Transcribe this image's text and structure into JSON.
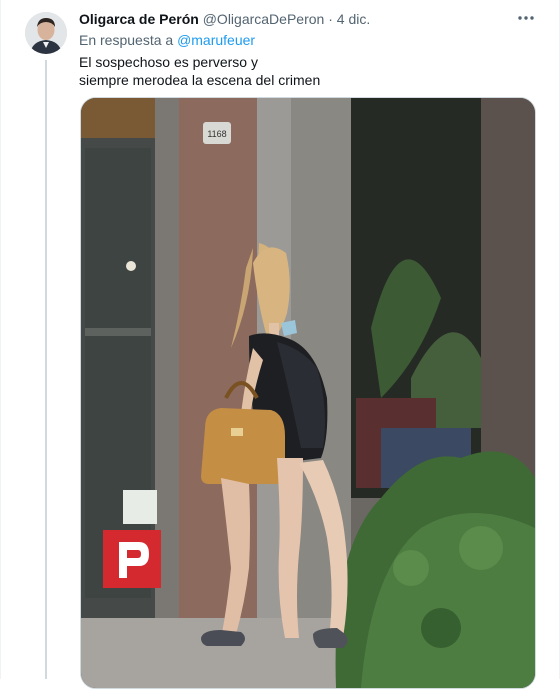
{
  "tweet": {
    "display_name": "Oligarca de Perón",
    "handle": "@OligarcaDePeron",
    "separator": "·",
    "date": "4 dic.",
    "reply_prefix": "En respuesta a",
    "reply_to": "@marufeuer",
    "text_lines": [
      "El sospechoso es perverso y",
      "siempre merodea la escena del crimen"
    ]
  },
  "media": {
    "description_icon": "photo",
    "door_number": "1168"
  },
  "colors": {
    "link": "#1d9bf0",
    "secondary_text": "#536471",
    "primary_text": "#0f1419",
    "thread_line": "#cfd9de",
    "parking_sign": "#d42a2f"
  },
  "icons": {
    "more": "more-dots-icon",
    "avatar": "profile-photo"
  }
}
